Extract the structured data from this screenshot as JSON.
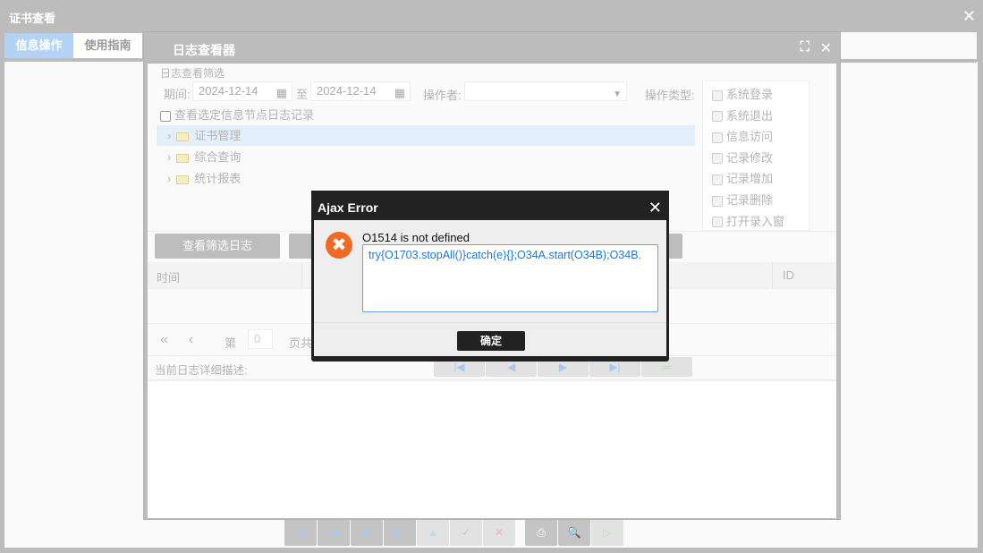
{
  "window": {
    "title": "证书查看",
    "close": "✕"
  },
  "tabs": [
    {
      "label": "信息操作"
    },
    {
      "label": "使用指南"
    }
  ],
  "log_viewer": {
    "title": "日志查看器",
    "maximize": "⛶",
    "close": "✕",
    "filter_title": "日志查看筛选",
    "period_label": "期间:",
    "date_from": "2024-12-14",
    "to_label": "至",
    "date_to": "2024-12-14",
    "operator_label": "操作者:",
    "operator_value": "",
    "op_type_label": "操作类型:",
    "op_types": [
      "系统登录",
      "系统退出",
      "信息访问",
      "记录修改",
      "记录增加",
      "记录删除",
      "打开录入窗"
    ],
    "node_checkbox_label": "查看选定信息节点日志记录",
    "tree": [
      "证书管理",
      "综合查询",
      "统计报表"
    ],
    "filter_button": "查看筛选日志",
    "columns": {
      "time": "时间",
      "id": "ID"
    },
    "pager": {
      "page_label": "第",
      "page_value": "0",
      "page_suffix": "页共"
    },
    "detail_label": "当前日志详细描述:"
  },
  "error": {
    "title": "Ajax Error",
    "close": "✕",
    "message": "O1514 is not defined",
    "detail": "try{O1703.stopAll()}catch(e){};O34A.start(O34B);O34B.",
    "ok": "确定"
  }
}
